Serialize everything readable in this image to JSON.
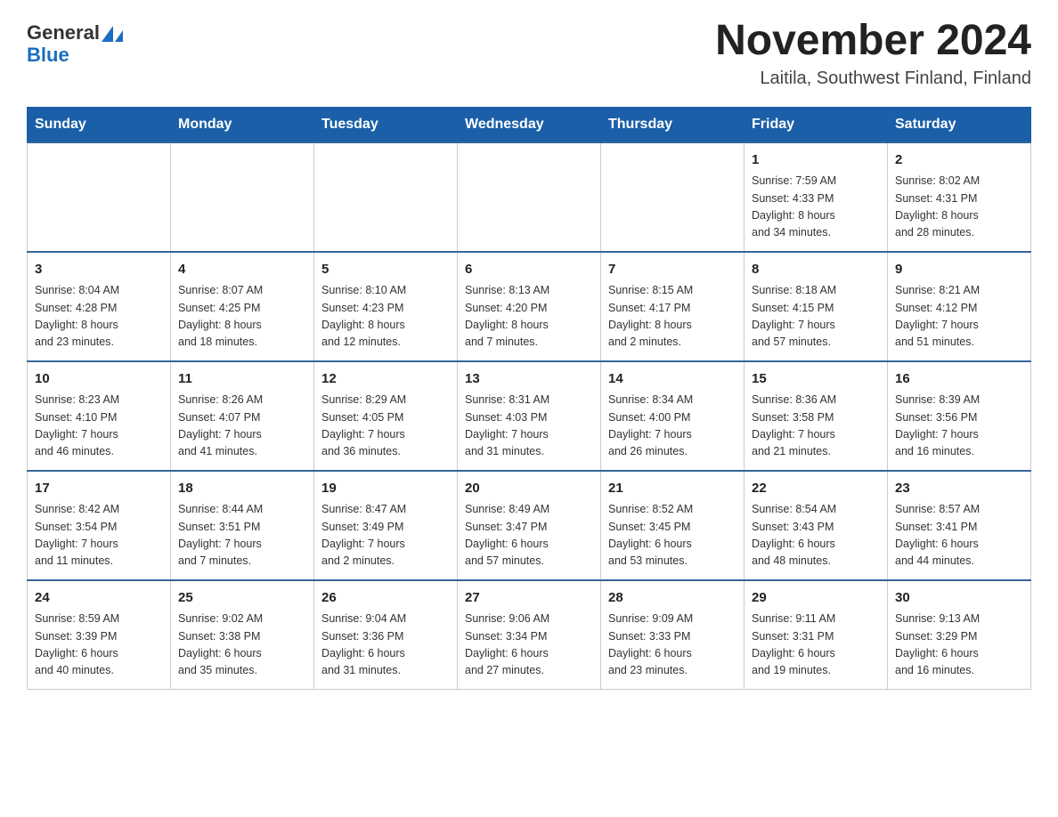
{
  "header": {
    "logo_general": "General",
    "logo_blue": "Blue",
    "month_title": "November 2024",
    "location": "Laitila, Southwest Finland, Finland"
  },
  "days_of_week": [
    "Sunday",
    "Monday",
    "Tuesday",
    "Wednesday",
    "Thursday",
    "Friday",
    "Saturday"
  ],
  "weeks": [
    [
      {
        "day": "",
        "info": ""
      },
      {
        "day": "",
        "info": ""
      },
      {
        "day": "",
        "info": ""
      },
      {
        "day": "",
        "info": ""
      },
      {
        "day": "",
        "info": ""
      },
      {
        "day": "1",
        "info": "Sunrise: 7:59 AM\nSunset: 4:33 PM\nDaylight: 8 hours\nand 34 minutes."
      },
      {
        "day": "2",
        "info": "Sunrise: 8:02 AM\nSunset: 4:31 PM\nDaylight: 8 hours\nand 28 minutes."
      }
    ],
    [
      {
        "day": "3",
        "info": "Sunrise: 8:04 AM\nSunset: 4:28 PM\nDaylight: 8 hours\nand 23 minutes."
      },
      {
        "day": "4",
        "info": "Sunrise: 8:07 AM\nSunset: 4:25 PM\nDaylight: 8 hours\nand 18 minutes."
      },
      {
        "day": "5",
        "info": "Sunrise: 8:10 AM\nSunset: 4:23 PM\nDaylight: 8 hours\nand 12 minutes."
      },
      {
        "day": "6",
        "info": "Sunrise: 8:13 AM\nSunset: 4:20 PM\nDaylight: 8 hours\nand 7 minutes."
      },
      {
        "day": "7",
        "info": "Sunrise: 8:15 AM\nSunset: 4:17 PM\nDaylight: 8 hours\nand 2 minutes."
      },
      {
        "day": "8",
        "info": "Sunrise: 8:18 AM\nSunset: 4:15 PM\nDaylight: 7 hours\nand 57 minutes."
      },
      {
        "day": "9",
        "info": "Sunrise: 8:21 AM\nSunset: 4:12 PM\nDaylight: 7 hours\nand 51 minutes."
      }
    ],
    [
      {
        "day": "10",
        "info": "Sunrise: 8:23 AM\nSunset: 4:10 PM\nDaylight: 7 hours\nand 46 minutes."
      },
      {
        "day": "11",
        "info": "Sunrise: 8:26 AM\nSunset: 4:07 PM\nDaylight: 7 hours\nand 41 minutes."
      },
      {
        "day": "12",
        "info": "Sunrise: 8:29 AM\nSunset: 4:05 PM\nDaylight: 7 hours\nand 36 minutes."
      },
      {
        "day": "13",
        "info": "Sunrise: 8:31 AM\nSunset: 4:03 PM\nDaylight: 7 hours\nand 31 minutes."
      },
      {
        "day": "14",
        "info": "Sunrise: 8:34 AM\nSunset: 4:00 PM\nDaylight: 7 hours\nand 26 minutes."
      },
      {
        "day": "15",
        "info": "Sunrise: 8:36 AM\nSunset: 3:58 PM\nDaylight: 7 hours\nand 21 minutes."
      },
      {
        "day": "16",
        "info": "Sunrise: 8:39 AM\nSunset: 3:56 PM\nDaylight: 7 hours\nand 16 minutes."
      }
    ],
    [
      {
        "day": "17",
        "info": "Sunrise: 8:42 AM\nSunset: 3:54 PM\nDaylight: 7 hours\nand 11 minutes."
      },
      {
        "day": "18",
        "info": "Sunrise: 8:44 AM\nSunset: 3:51 PM\nDaylight: 7 hours\nand 7 minutes."
      },
      {
        "day": "19",
        "info": "Sunrise: 8:47 AM\nSunset: 3:49 PM\nDaylight: 7 hours\nand 2 minutes."
      },
      {
        "day": "20",
        "info": "Sunrise: 8:49 AM\nSunset: 3:47 PM\nDaylight: 6 hours\nand 57 minutes."
      },
      {
        "day": "21",
        "info": "Sunrise: 8:52 AM\nSunset: 3:45 PM\nDaylight: 6 hours\nand 53 minutes."
      },
      {
        "day": "22",
        "info": "Sunrise: 8:54 AM\nSunset: 3:43 PM\nDaylight: 6 hours\nand 48 minutes."
      },
      {
        "day": "23",
        "info": "Sunrise: 8:57 AM\nSunset: 3:41 PM\nDaylight: 6 hours\nand 44 minutes."
      }
    ],
    [
      {
        "day": "24",
        "info": "Sunrise: 8:59 AM\nSunset: 3:39 PM\nDaylight: 6 hours\nand 40 minutes."
      },
      {
        "day": "25",
        "info": "Sunrise: 9:02 AM\nSunset: 3:38 PM\nDaylight: 6 hours\nand 35 minutes."
      },
      {
        "day": "26",
        "info": "Sunrise: 9:04 AM\nSunset: 3:36 PM\nDaylight: 6 hours\nand 31 minutes."
      },
      {
        "day": "27",
        "info": "Sunrise: 9:06 AM\nSunset: 3:34 PM\nDaylight: 6 hours\nand 27 minutes."
      },
      {
        "day": "28",
        "info": "Sunrise: 9:09 AM\nSunset: 3:33 PM\nDaylight: 6 hours\nand 23 minutes."
      },
      {
        "day": "29",
        "info": "Sunrise: 9:11 AM\nSunset: 3:31 PM\nDaylight: 6 hours\nand 19 minutes."
      },
      {
        "day": "30",
        "info": "Sunrise: 9:13 AM\nSunset: 3:29 PM\nDaylight: 6 hours\nand 16 minutes."
      }
    ]
  ]
}
